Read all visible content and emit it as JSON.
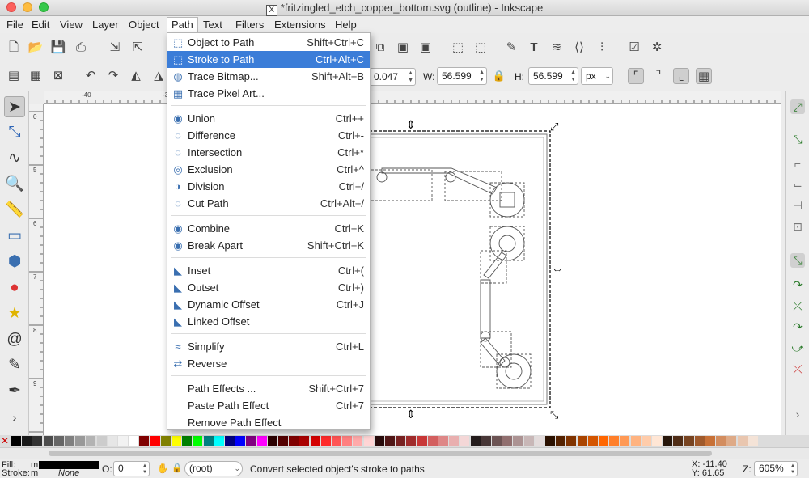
{
  "window": {
    "title": "*fritzingled_etch_copper_bottom.svg (outline) - Inkscape"
  },
  "menubar": [
    "File",
    "Edit",
    "View",
    "Layer",
    "Object",
    "Path",
    "Text",
    "Filters",
    "Extensions",
    "Help"
  ],
  "path_menu": {
    "groups": [
      [
        {
          "label": "Object to Path",
          "shortcut": "Shift+Ctrl+C",
          "icon": "object-to-path-icon",
          "glyph": "⬚"
        },
        {
          "label": "Stroke to Path",
          "shortcut": "Ctrl+Alt+C",
          "icon": "stroke-to-path-icon",
          "glyph": "⬚",
          "highlighted": true
        },
        {
          "label": "Trace Bitmap...",
          "shortcut": "Shift+Alt+B",
          "icon": "trace-bitmap-icon",
          "glyph": "◍"
        },
        {
          "label": "Trace Pixel Art...",
          "shortcut": "",
          "icon": "trace-pixel-art-icon",
          "glyph": "▦"
        }
      ],
      [
        {
          "label": "Union",
          "shortcut": "Ctrl++",
          "icon": "union-icon",
          "glyph": "◉"
        },
        {
          "label": "Difference",
          "shortcut": "Ctrl+-",
          "icon": "difference-icon",
          "glyph": "◌"
        },
        {
          "label": "Intersection",
          "shortcut": "Ctrl+*",
          "icon": "intersection-icon",
          "glyph": "◌"
        },
        {
          "label": "Exclusion",
          "shortcut": "Ctrl+^",
          "icon": "exclusion-icon",
          "glyph": "◎"
        },
        {
          "label": "Division",
          "shortcut": "Ctrl+/",
          "icon": "division-icon",
          "glyph": "◑"
        },
        {
          "label": "Cut Path",
          "shortcut": "Ctrl+Alt+/",
          "icon": "cut-path-icon",
          "glyph": "◌"
        }
      ],
      [
        {
          "label": "Combine",
          "shortcut": "Ctrl+K",
          "icon": "combine-icon",
          "glyph": "◉"
        },
        {
          "label": "Break Apart",
          "shortcut": "Shift+Ctrl+K",
          "icon": "break-apart-icon",
          "glyph": "◉"
        }
      ],
      [
        {
          "label": "Inset",
          "shortcut": "Ctrl+(",
          "icon": "inset-icon",
          "glyph": "◣"
        },
        {
          "label": "Outset",
          "shortcut": "Ctrl+)",
          "icon": "outset-icon",
          "glyph": "◣"
        },
        {
          "label": "Dynamic Offset",
          "shortcut": "Ctrl+J",
          "icon": "dynamic-offset-icon",
          "glyph": "◣"
        },
        {
          "label": "Linked Offset",
          "shortcut": "",
          "icon": "linked-offset-icon",
          "glyph": "◣"
        }
      ],
      [
        {
          "label": "Simplify",
          "shortcut": "Ctrl+L",
          "icon": "simplify-icon",
          "glyph": "≈"
        },
        {
          "label": "Reverse",
          "shortcut": "",
          "icon": "reverse-icon",
          "glyph": "⇄"
        }
      ],
      [
        {
          "label": "Path Effects ...",
          "shortcut": "Shift+Ctrl+7",
          "icon": "",
          "glyph": ""
        },
        {
          "label": "Paste Path Effect",
          "shortcut": "Ctrl+7",
          "icon": "",
          "glyph": ""
        },
        {
          "label": "Remove Path Effect",
          "shortcut": "",
          "icon": "",
          "glyph": ""
        }
      ]
    ]
  },
  "controls": {
    "x_value": "0.047",
    "w_label": "W:",
    "w_value": "56.599",
    "h_label": "H:",
    "h_value": "56.599",
    "unit": "px"
  },
  "rulers": {
    "top": [
      "-40",
      "-30"
    ],
    "left": [
      "0",
      "5",
      "6",
      "7",
      "8",
      "9"
    ]
  },
  "status": {
    "fill_label": "Fill:",
    "fill_value": "m",
    "stroke_label": "Stroke:",
    "stroke_value": "m",
    "stroke_none": "None",
    "opacity_label": "O:",
    "opacity_value": "0",
    "layer": "(root)",
    "message": "Convert selected object's stroke to paths",
    "x_coord": "X: -11.40",
    "y_coord": "Y: 61.65",
    "zoom_label": "Z:",
    "zoom_value": "605%"
  },
  "palette_colors": [
    "#000000",
    "#1a1a1a",
    "#333333",
    "#4d4d4d",
    "#666666",
    "#808080",
    "#999999",
    "#b3b3b3",
    "#cccccc",
    "#e6e6e6",
    "#f2f2f2",
    "#ffffff",
    "#800000",
    "#ff0000",
    "#808000",
    "#ffff00",
    "#008000",
    "#00ff00",
    "#008080",
    "#00ffff",
    "#000080",
    "#0000ff",
    "#800080",
    "#ff00ff",
    "#2b0000",
    "#550000",
    "#800000",
    "#aa0000",
    "#d40000",
    "#ff2a2a",
    "#ff5555",
    "#ff8080",
    "#ffaaaa",
    "#ffd5d5",
    "#280b0b",
    "#501616",
    "#782121",
    "#a02c2c",
    "#c83737",
    "#d35f5f",
    "#de8787",
    "#e9afaf",
    "#f4d7d7",
    "#241c1c",
    "#483737",
    "#6c5353",
    "#916f6f",
    "#ac9393",
    "#c8b7b7",
    "#e3dbdb",
    "#2b1100",
    "#552200",
    "#803300",
    "#aa4400",
    "#d45500",
    "#ff6600",
    "#ff7f2a",
    "#ff9955",
    "#ffb380",
    "#ffccaa",
    "#ffe6d5",
    "#28170b",
    "#502d16",
    "#784421",
    "#a05a2c",
    "#c87137",
    "#d38d5f",
    "#deaa87",
    "#e9c6af",
    "#f4e3d7"
  ]
}
